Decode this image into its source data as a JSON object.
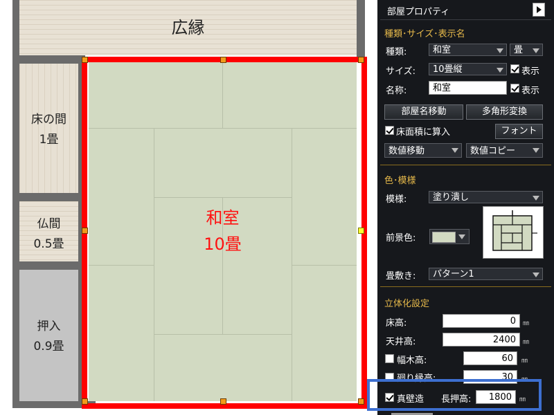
{
  "plan": {
    "rooms": {
      "engawa": "広縁",
      "tokonoma_name": "床の間",
      "tokonoma_size": "1畳",
      "butsuma_name": "仏間",
      "butsuma_size": "0.5畳",
      "oshiire_name": "押入",
      "oshiire_size": "0.9畳",
      "washitsu_name": "和室",
      "washitsu_size": "10畳"
    },
    "colors": {
      "selection": "#ff0000",
      "tatami": "#d2dac2",
      "wall": "#6b6b6b",
      "oshiire": "#c4c4c4"
    }
  },
  "panel": {
    "title": "部屋プロパティ",
    "section1": {
      "header": "種類･サイズ･表示名",
      "type_label": "種類:",
      "type_value": "和室",
      "unit_value": "畳",
      "size_label": "サイズ:",
      "size_value": "10畳縦",
      "show_label": "表示",
      "name_label": "名称:",
      "name_value": "和室",
      "btn_move_name": "部屋名移動",
      "btn_polygon": "多角形変換",
      "floor_area_label": "床面積に算入",
      "btn_font": "フォント",
      "numeric_move": "数値移動",
      "numeric_copy": "数値コピー"
    },
    "section2": {
      "header": "色･模様",
      "pattern_label": "模様:",
      "pattern_value": "塗り潰し",
      "fg_label": "前景色:",
      "tatami_label": "畳敷き:",
      "tatami_value": "パターン1"
    },
    "section3": {
      "header": "立体化設定",
      "floor_h_label": "床高:",
      "floor_h_value": "0",
      "ceiling_h_label": "天井高:",
      "ceiling_h_value": "2400",
      "baseboard_label": "幅木高:",
      "baseboard_value": "60",
      "mawaribuchi_label": "廻り縁高:",
      "mawaribuchi_value": "30",
      "shinkabe_label": "真壁造",
      "nageshi_label": "長押高:",
      "nageshi_value": "1800",
      "unit": "㎜"
    }
  }
}
